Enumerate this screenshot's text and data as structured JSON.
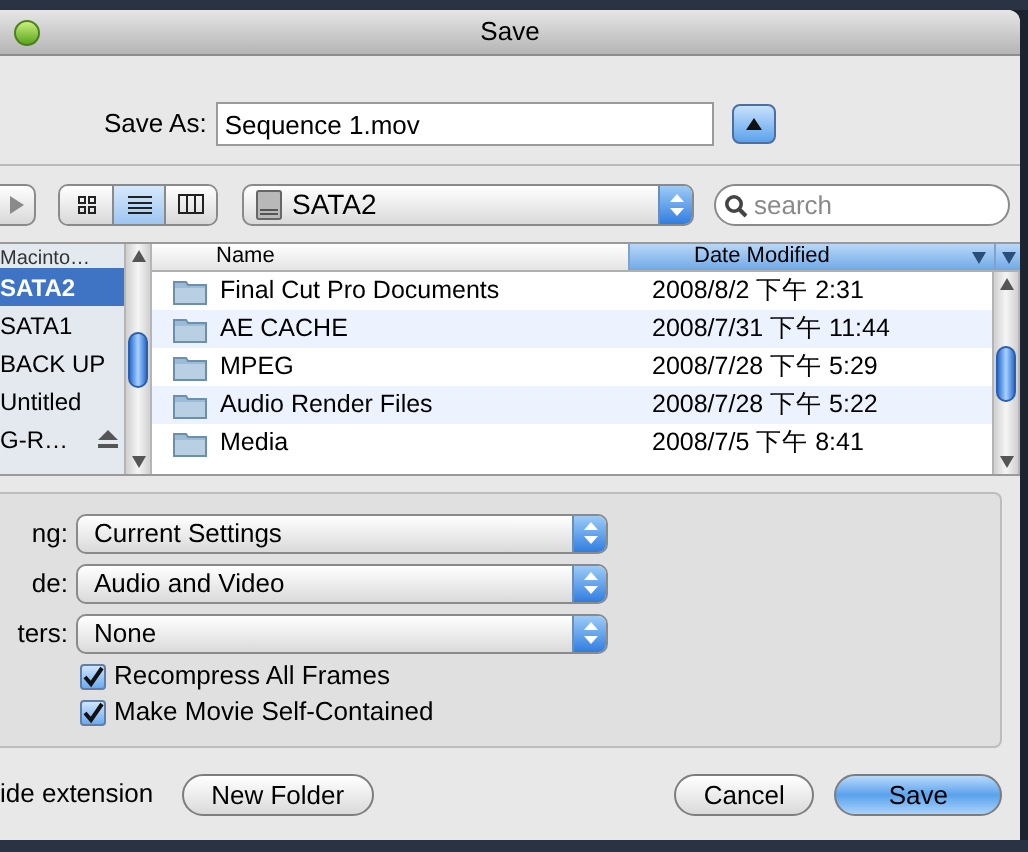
{
  "window": {
    "title": "Save"
  },
  "save_as": {
    "label": "Save As:",
    "value": "Sequence 1.mov"
  },
  "view_modes": [
    {
      "kind": "icon",
      "selected": false
    },
    {
      "kind": "list",
      "selected": true
    },
    {
      "kind": "column",
      "selected": false
    }
  ],
  "location": {
    "value": "SATA2"
  },
  "search": {
    "placeholder": "search"
  },
  "sidebar": {
    "items": [
      {
        "label": "Macinto…",
        "selected": false,
        "eject": false
      },
      {
        "label": "SATA2",
        "selected": true,
        "eject": false
      },
      {
        "label": "SATA1",
        "selected": false,
        "eject": false
      },
      {
        "label": "BACK UP",
        "selected": false,
        "eject": false
      },
      {
        "label": "Untitled",
        "selected": false,
        "eject": false
      },
      {
        "label": "G-R…",
        "selected": false,
        "eject": true
      }
    ]
  },
  "table": {
    "columns": [
      {
        "label": "Name",
        "sorted": false
      },
      {
        "label": "Date Modified",
        "sorted": true
      }
    ],
    "rows": [
      {
        "name": "Final Cut Pro Documents",
        "date": "2008/8/2 下午 2:31"
      },
      {
        "name": "AE CACHE",
        "date": "2008/7/31 下午 11:44"
      },
      {
        "name": "MPEG",
        "date": "2008/7/28 下午 5:29"
      },
      {
        "name": "Audio Render Files",
        "date": "2008/7/28 下午 5:22"
      },
      {
        "name": "Media",
        "date": "2008/7/5 下午 8:41"
      }
    ]
  },
  "options": [
    {
      "label": "ng:",
      "value": "Current Settings"
    },
    {
      "label": "de:",
      "value": "Audio and Video"
    },
    {
      "label": "ters:",
      "value": "None"
    }
  ],
  "checkboxes": [
    {
      "label": "Recompress All Frames",
      "checked": true
    },
    {
      "label": "Make Movie Self-Contained",
      "checked": true
    }
  ],
  "hide_extension": {
    "label": "ide extension"
  },
  "buttons": [
    {
      "label": "New Folder",
      "default": false
    },
    {
      "label": "Cancel",
      "default": false
    },
    {
      "label": "Save",
      "default": true
    }
  ]
}
